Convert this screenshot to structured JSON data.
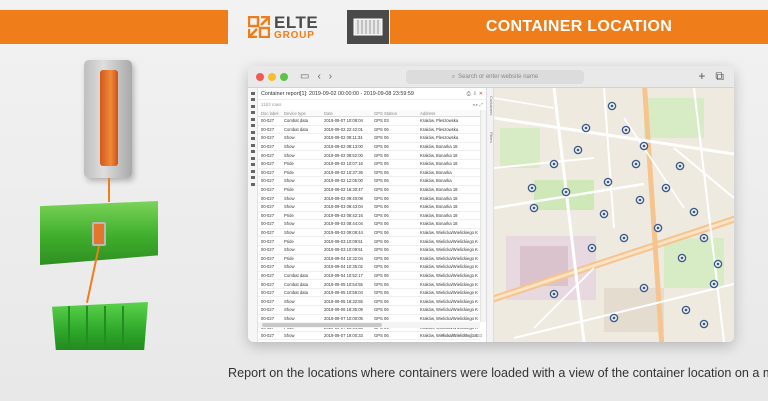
{
  "header": {
    "brand_top": "ELTE",
    "brand_bottom": "GROUP",
    "title": "CONTAINER LOCATION",
    "accent_color": "#ef7d1a",
    "logo_icon": "elte-arrows-logo",
    "section_icon": "container-icon"
  },
  "browser": {
    "url_placeholder": "Search or enter website name",
    "new_tab_label": "+",
    "tabs_icon": "tabs-icon"
  },
  "report": {
    "title": "Container report[1]: 2019-09-02 00:00:00 - 2019-09-08 23:59:59",
    "subtitle": "1163 rows",
    "columns": [
      "Doc label",
      "Device type",
      "Date",
      "GPS Station",
      "Address"
    ],
    "rows": [
      [
        "00-027",
        "Combat data",
        "2019-09-07 10:08:04",
        "GPS 03",
        "Kraków, Pleszowska"
      ],
      [
        "00-027",
        "Combat data",
        "2019-09-02 22:42:01",
        "GPS 06",
        "Kraków, Pleszowska"
      ],
      [
        "00-027",
        "Show",
        "2019-09-02 08:11:34",
        "GPS 06",
        "Kraków, Pleszowska"
      ],
      [
        "00-027",
        "Show",
        "2019-09-02 08:13:00",
        "GPS 06",
        "Kraków, Bonarka 18"
      ],
      [
        "00-027",
        "Show",
        "2019-09-02 08:52:00",
        "GPS 06",
        "Kraków, Bonarka 18"
      ],
      [
        "00-027",
        "Pride",
        "2019-09-02 10:07:16",
        "GPS 06",
        "Kraków, Bonarka 18"
      ],
      [
        "00-027",
        "Pride",
        "2019-09-02 10:37:36",
        "GPS 06",
        "Kraków, Bonarka"
      ],
      [
        "00-027",
        "Show",
        "2019-09-02 12:05:00",
        "GPS 06",
        "Kraków, Bonarka"
      ],
      [
        "00-027",
        "Pride",
        "2019-09-02 16:30:47",
        "GPS 06",
        "Kraków, Bonarka 18"
      ],
      [
        "00-027",
        "Show",
        "2019-09-02 09:40:08",
        "GPS 06",
        "Kraków, Bonarka 18"
      ],
      [
        "00-027",
        "Show",
        "2019-09-03 08:43:04",
        "GPS 06",
        "Kraków, Bonarka 18"
      ],
      [
        "00-027",
        "Pride",
        "2019-09-03 08:42:16",
        "GPS 06",
        "Kraków, Bonarka 18"
      ],
      [
        "00-027",
        "Show",
        "2019-09-03 08:44:04",
        "GPS 06",
        "Kraków, Bonarka 18"
      ],
      [
        "00-027",
        "Show",
        "2019-09-03 09:08:44",
        "GPS 06",
        "Kraków, Wielicka/Wielickiego Komenda"
      ],
      [
        "00-027",
        "Pride",
        "2019-09-03 10:09:51",
        "GPS 06",
        "Kraków, Wielicka/Wielickiego Komenda"
      ],
      [
        "00-027",
        "Show",
        "2019-09-03 10:09:51",
        "GPS 06",
        "Kraków, Wielicka/Wielickiego Komenda"
      ],
      [
        "00-027",
        "Pride",
        "2019-09-04 10:32:04",
        "GPS 06",
        "Kraków, Wielicka/Wielickiego Komenda"
      ],
      [
        "00-027",
        "Show",
        "2019-09-04 10:35:02",
        "GPS 06",
        "Kraków, Wielicka/Wielickiego Komenda"
      ],
      [
        "00-027",
        "Combat data",
        "2019-09-04 10:52:17",
        "GPS 06",
        "Kraków, Wielicka/Wielickiego Komenda"
      ],
      [
        "00-027",
        "Combat data",
        "2019-09-05 10:54:55",
        "GPS 06",
        "Kraków, Wielicka/Wielickiego Komenda"
      ],
      [
        "00-027",
        "Combat data",
        "2019-09-05 10:59:04",
        "GPS 06",
        "Kraków, Wielicka/Wielickiego Komenda"
      ],
      [
        "00-027",
        "Show",
        "2019-09-05 18:32:55",
        "GPS 06",
        "Kraków, Wielicka/Wielickiego Komenda"
      ],
      [
        "00-027",
        "Show",
        "2019-09-06 18:35:09",
        "GPS 06",
        "Kraków, Wielicka/Wielickiego Komenda"
      ],
      [
        "00-027",
        "Show",
        "2019-09-07 10:00:05",
        "GPS 06",
        "Kraków, Wielicka/Wielickiego Komenda"
      ],
      [
        "00-027",
        "Pride",
        "2019-09-07 10:44:53",
        "GPS 06",
        "Kraków, Wielicka/Wielickiego Komenda"
      ],
      [
        "00-027",
        "Show",
        "2019-09-07 19:00:33",
        "GPS 06",
        "Kraków, Wielicka/Wielickiego Komenda"
      ],
      [
        "00-027",
        "Pride",
        "2019-09-07 23:43:00",
        "GPS 06",
        "Kraków, Wielicka/Wielickiego Komenda"
      ]
    ],
    "footer": "Records 1–27 of 1163",
    "side_tabs": [
      "Containers",
      "Filters"
    ]
  },
  "caption": "Report on the locations where containers were loaded with a view of the container location on a map.",
  "colors": {
    "orange": "#ef7d1a",
    "dark_grey": "#4a4a4a",
    "device_green": "#3fae2c",
    "map_marker": "#3c5a8a"
  }
}
